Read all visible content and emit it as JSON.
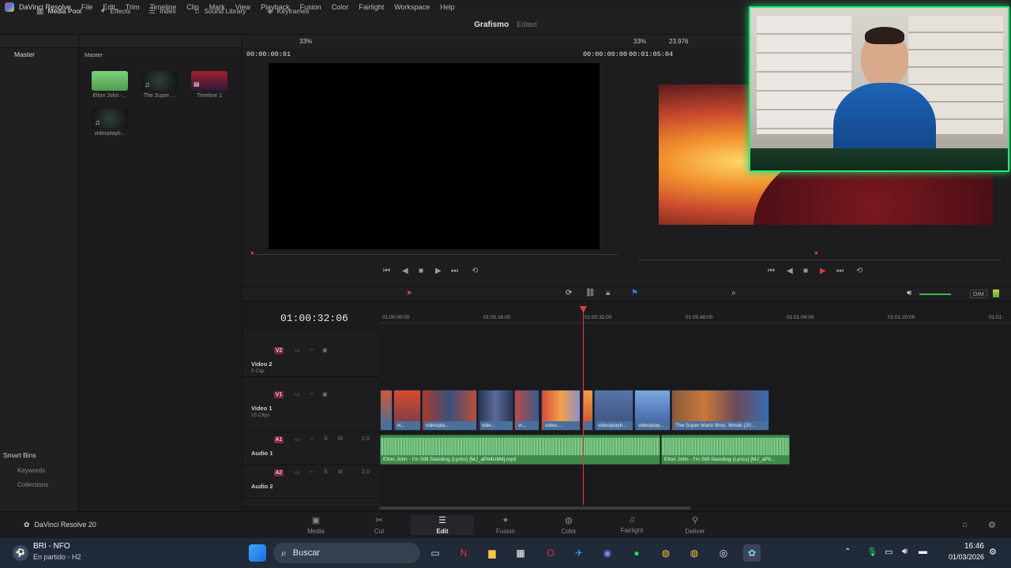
{
  "app": {
    "name": "DaVinci Resolve",
    "menu": [
      "File",
      "Edit",
      "Trim",
      "Timeline",
      "Clip",
      "Mark",
      "View",
      "Playback",
      "Fusion",
      "Color",
      "Fairlight",
      "Workspace",
      "Help"
    ]
  },
  "toolbar": {
    "media_pool": "Media Pool",
    "effects": "Effects",
    "index": "Index",
    "sound_library": "Sound Library",
    "keyframes": "Keyframes",
    "project_name": "Grafismo",
    "project_status": "Edited"
  },
  "bins": {
    "root": "Master",
    "smart_bins": "Smart Bins",
    "smart_items": [
      "Keywords",
      "Collections"
    ]
  },
  "media_pool": {
    "header": "Master",
    "items": [
      {
        "label": "Elton John -..."
      },
      {
        "label": "The Super ..."
      },
      {
        "label": "Timeline 1"
      },
      {
        "label": "videoplayb..."
      }
    ]
  },
  "source_viewer": {
    "zoom": "33%",
    "timecode_left": "00:00:00:01",
    "timecode_right": "00:00:00:00"
  },
  "program_viewer": {
    "duration": "00:01:05:04",
    "zoom": "33%",
    "fps": "23.976"
  },
  "timeline": {
    "current_timecode": "01:00:32:06",
    "ruler": [
      "01:00:00:00",
      "01:00:16:00",
      "01:00:32:00",
      "01:00:48:00",
      "01:01:04:00",
      "01:01:20:00",
      "01:01:"
    ],
    "tracks": [
      {
        "tag": "V2",
        "name": "Video 2",
        "sub": "0 Clip"
      },
      {
        "tag": "V1",
        "name": "Video 1",
        "sub": "15 Clips"
      },
      {
        "tag": "A1",
        "name": "Audio 1",
        "channels": "2.0"
      },
      {
        "tag": "A2",
        "name": "Audio 2",
        "channels": "2.0"
      }
    ],
    "video_clips": [
      "vi...",
      "videopla...",
      "vide...",
      "vi...",
      "video...",
      "videoplayb...",
      "videoplay...",
      "The Super Mario Bros. Movie (20..."
    ],
    "audio_clips": [
      "Elton John - I'm Still Standing (Lyrics) [MJ_aPtt4U8M].mp3",
      "Elton John - I'm Still Standing (Lyrics) [MJ_aPtt..."
    ],
    "dim": "DIM"
  },
  "pages": {
    "product": "DaVinci Resolve 20",
    "tabs": [
      "Media",
      "Cut",
      "Edit",
      "Fusion",
      "Color",
      "Fairlight",
      "Deliver"
    ],
    "active": "Edit"
  },
  "taskbar": {
    "stream_title": "BRI - NFO",
    "stream_sub": "En partido - H2",
    "search_placeholder": "Buscar",
    "time": "16:46",
    "date": "01/03/2026"
  },
  "colors": {
    "accent_red": "#e13b3b",
    "video_clip": "#4a6f9a",
    "audio_clip": "#3f8a4b",
    "webcam_border": "#2de878"
  }
}
